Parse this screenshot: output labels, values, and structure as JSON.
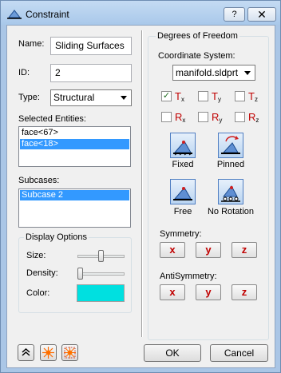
{
  "window": {
    "title": "Constraint",
    "help_label": "?",
    "close_label": "✕"
  },
  "general": {
    "name_label": "Name:",
    "name_value": "Sliding Surfaces",
    "id_label": "ID:",
    "id_value": "2",
    "type_label": "Type:",
    "type_value": "Structural",
    "selected_label": "Selected Entities:",
    "selected_items": [
      "face<67>",
      "face<18>"
    ],
    "subcases_label": "Subcases:",
    "subcases_items": [
      "Subcase 2"
    ]
  },
  "display": {
    "title": "Display Options",
    "size_label": "Size:",
    "size_value": 0.5,
    "density_label": "Density:",
    "density_value": 0.0,
    "color_label": "Color:",
    "color_value": "#00e0e0"
  },
  "dof": {
    "title": "Degrees of Freedom",
    "coord_label": "Coordinate System:",
    "coord_value": "manifold.sldprt",
    "translations": [
      {
        "main": "T",
        "sub": "x",
        "checked": true
      },
      {
        "main": "T",
        "sub": "y",
        "checked": false
      },
      {
        "main": "T",
        "sub": "z",
        "checked": false
      }
    ],
    "rotations": [
      {
        "main": "R",
        "sub": "x",
        "checked": false
      },
      {
        "main": "R",
        "sub": "y",
        "checked": false
      },
      {
        "main": "R",
        "sub": "z",
        "checked": false
      }
    ],
    "check_mark": "✓",
    "presets": [
      "Fixed",
      "Pinned",
      "Free",
      "No Rotation"
    ]
  },
  "symmetry": {
    "label": "Symmetry:",
    "x": "x",
    "y": "y",
    "z": "z"
  },
  "antisymmetry": {
    "label": "AntiSymmetry:",
    "x": "x",
    "y": "y",
    "z": "z"
  },
  "footer": {
    "ok_label": "OK",
    "cancel_label": "Cancel"
  },
  "colors": {
    "accent": "#3399ff",
    "dof_red": "#c00000",
    "chrome": "#aac6e6"
  }
}
